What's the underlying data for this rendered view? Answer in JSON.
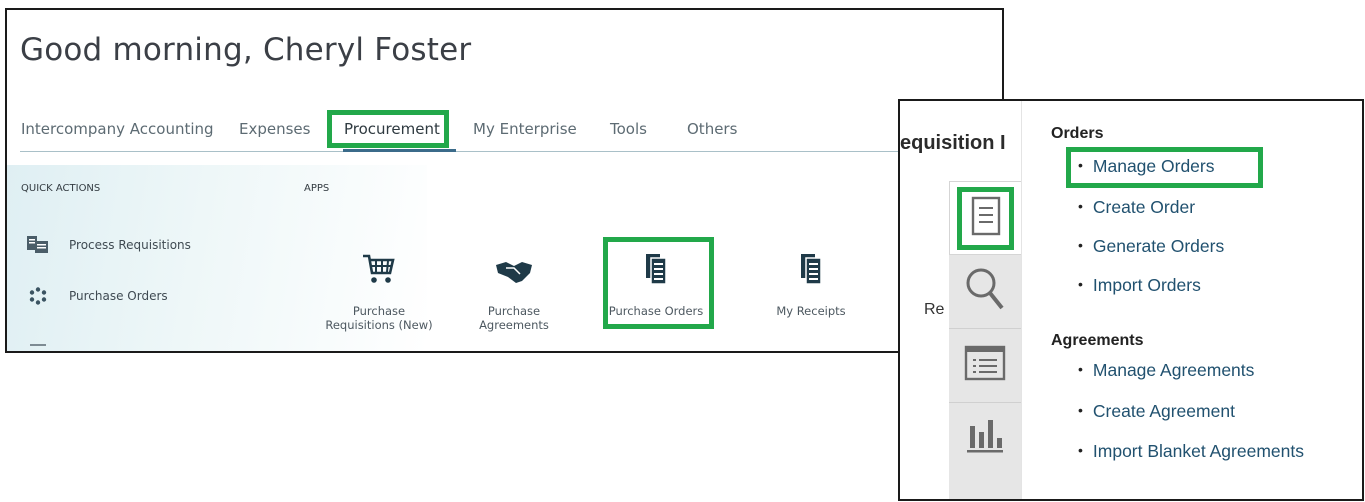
{
  "left_panel": {
    "greeting": "Good morning, Cheryl Foster",
    "tabs": [
      {
        "label": "Intercompany Accounting"
      },
      {
        "label": "Expenses"
      },
      {
        "label": "Procurement"
      },
      {
        "label": "My Enterprise"
      },
      {
        "label": "Tools"
      },
      {
        "label": "Others"
      }
    ],
    "active_tab": "Procurement",
    "quick_actions": {
      "heading": "QUICK ACTIONS",
      "items": [
        {
          "label": "Process Requisitions",
          "icon": "process-requisitions-icon"
        },
        {
          "label": "Purchase Orders",
          "icon": "purchase-orders-spinner-icon"
        }
      ]
    },
    "apps": {
      "heading": "APPS",
      "items": [
        {
          "line1": "Purchase",
          "line2": "Requisitions (New)",
          "icon": "shopping-cart-icon"
        },
        {
          "line1": "Purchase",
          "line2": "Agreements",
          "icon": "handshake-icon"
        },
        {
          "line1": "Purchase Orders",
          "line2": "",
          "icon": "document-stack-icon"
        },
        {
          "line1": "My Receipts",
          "line2": "",
          "icon": "document-stack-icon"
        }
      ]
    }
  },
  "right_panel": {
    "heading_fragment": "equisition I",
    "side_text_fragment": "Re",
    "sidebar_tiles": [
      "tasks-icon",
      "search-icon",
      "list-icon",
      "bar-chart-icon"
    ],
    "menu": {
      "orders_heading": "Orders",
      "orders": [
        "Manage Orders",
        "Create Order",
        "Generate Orders",
        "Import Orders"
      ],
      "agreements_heading": "Agreements",
      "agreements": [
        "Manage Agreements",
        "Create Agreement",
        "Import Blanket Agreements"
      ]
    }
  },
  "colors": {
    "highlight": "#22a84a",
    "link": "#21516f",
    "tab_text": "#5d6b73",
    "active_underline": "#3b6b8a"
  }
}
